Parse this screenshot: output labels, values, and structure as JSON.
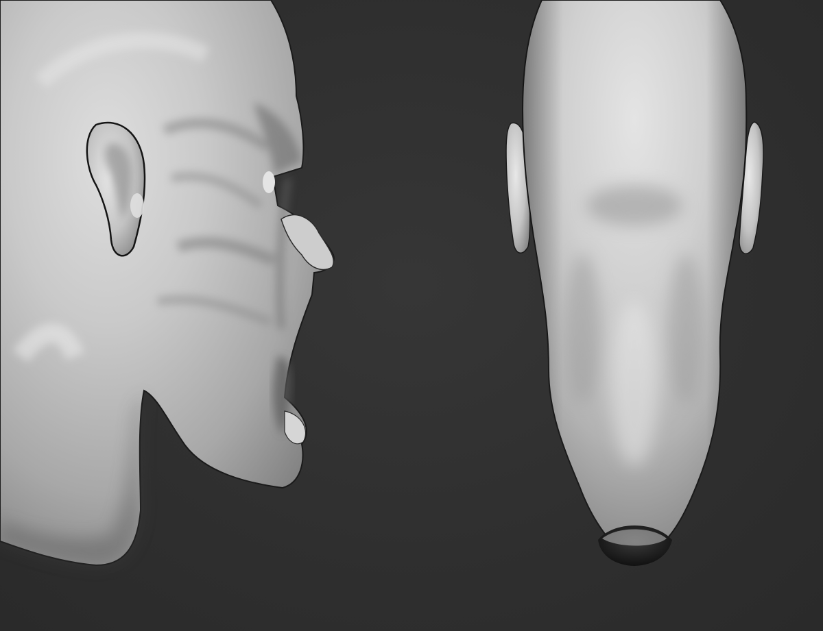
{
  "viewport": {
    "background_color": "#2e2e2e",
    "material_color": "#bdbdbd"
  },
  "models": {
    "side_view": {
      "icon": "sculpt-head-profile"
    },
    "back_view": {
      "icon": "sculpt-head-back"
    }
  }
}
